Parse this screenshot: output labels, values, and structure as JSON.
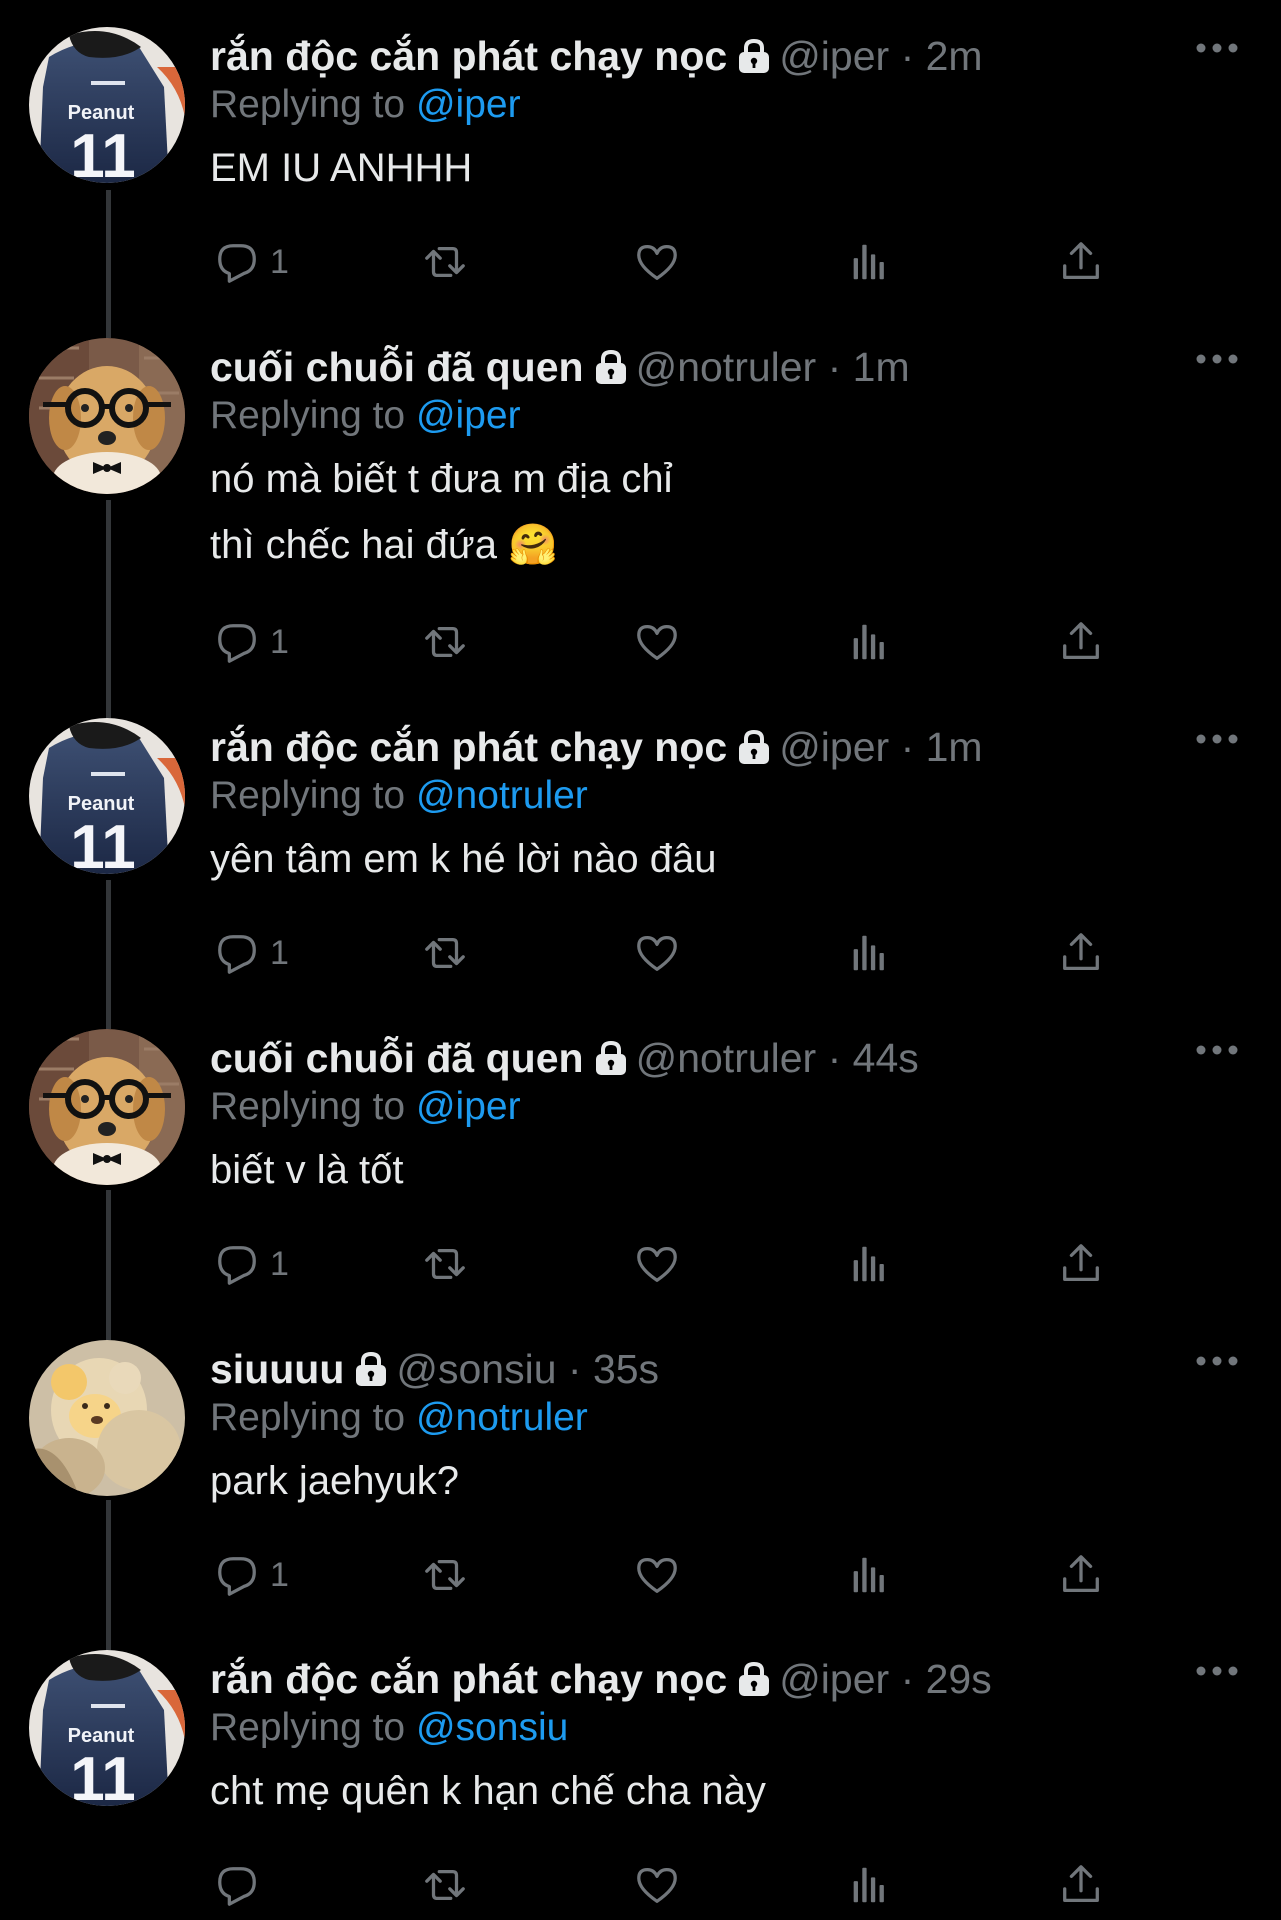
{
  "tweets": [
    {
      "avatar": "peanut-jersey",
      "name": "rắn độc cắn phát chạy nọc",
      "handle": "@iper",
      "time": "2m",
      "replying_label": "Replying to",
      "replying_to": "@iper",
      "lines": [
        "EM IU ANHHH"
      ],
      "reply_count": "1"
    },
    {
      "avatar": "dog-glasses",
      "name": "cuối chuỗi đã quen",
      "handle": "@notruler",
      "time": "1m",
      "replying_label": "Replying to",
      "replying_to": "@iper",
      "lines": [
        "nó mà biết t đưa m địa chỉ",
        "thì chếc hai đứa 🤗"
      ],
      "reply_count": "1"
    },
    {
      "avatar": "peanut-jersey",
      "name": "rắn độc cắn phát chạy nọc",
      "handle": "@iper",
      "time": "1m",
      "replying_label": "Replying to",
      "replying_to": "@notruler",
      "lines": [
        "yên tâm em k hé lời nào đâu"
      ],
      "reply_count": "1"
    },
    {
      "avatar": "dog-glasses",
      "name": "cuối chuỗi đã quen",
      "handle": "@notruler",
      "time": "44s",
      "replying_label": "Replying to",
      "replying_to": "@iper",
      "lines": [
        "biết v là tốt"
      ],
      "reply_count": "1"
    },
    {
      "avatar": "teddy-bear",
      "name": "siuuuu",
      "handle": "@sonsiu",
      "time": "35s",
      "replying_label": "Replying to",
      "replying_to": "@notruler",
      "lines": [
        "park jaehyuk?"
      ],
      "reply_count": "1"
    },
    {
      "avatar": "peanut-jersey",
      "name": "rắn độc cắn phát chạy nọc",
      "handle": "@iper",
      "time": "29s",
      "replying_label": "Replying to",
      "replying_to": "@sonsiu",
      "lines": [
        "cht mẹ quên k hạn chế cha này"
      ],
      "reply_count": ""
    }
  ],
  "jersey": {
    "name": "Peanut",
    "number": "11"
  },
  "colors": {
    "link": "#1d9bf0",
    "muted": "#71767b",
    "text": "#e7e9ea",
    "background": "#000000"
  }
}
